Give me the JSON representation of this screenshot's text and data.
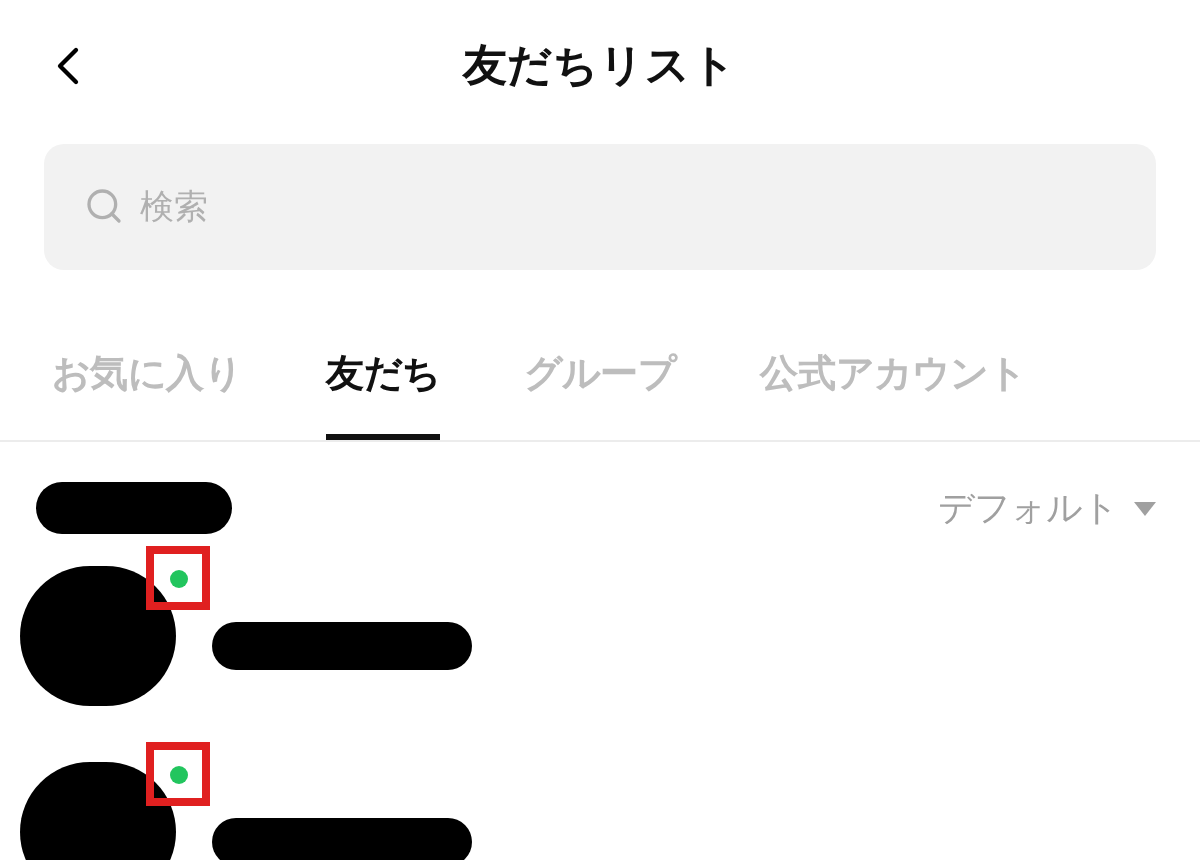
{
  "header": {
    "title": "友だちリスト"
  },
  "search": {
    "placeholder": "検索"
  },
  "tabs": [
    {
      "label": "お気に入り",
      "selected": false
    },
    {
      "label": "友だち",
      "selected": true
    },
    {
      "label": "グループ",
      "selected": false
    },
    {
      "label": "公式アカウント",
      "selected": false
    }
  ],
  "sort": {
    "label": "デフォルト"
  },
  "friends": [
    {
      "online": true
    },
    {
      "online": true
    }
  ]
}
